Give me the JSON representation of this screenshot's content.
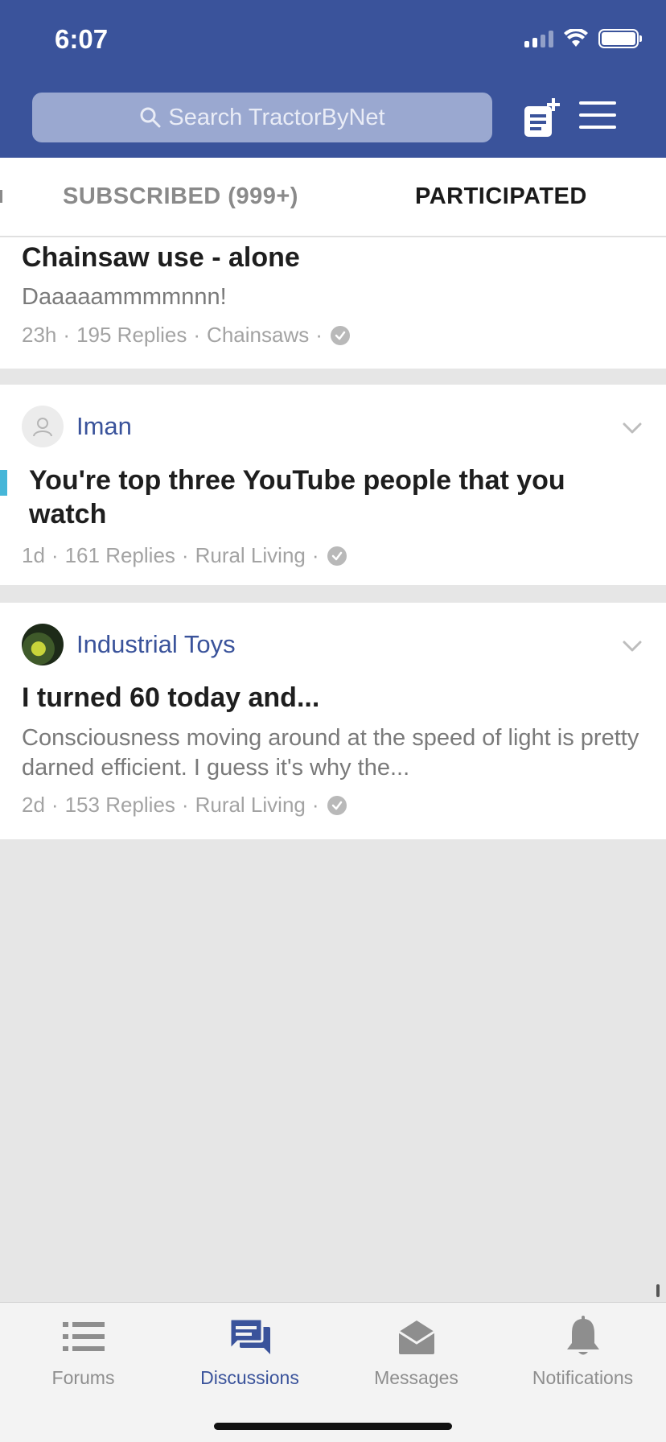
{
  "status_bar": {
    "time": "6:07"
  },
  "header": {
    "search_placeholder": "Search TractorByNet",
    "compose_icon": "new-post-icon",
    "menu_icon": "hamburger-menu-icon"
  },
  "tabs": [
    {
      "label": "SUBSCRIBED (999+)",
      "active": false
    },
    {
      "label": "PARTICIPATED",
      "active": true
    }
  ],
  "threads": [
    {
      "title": "Chainsaw use - alone",
      "snippet": "Daaaaammmmnnn!",
      "age": "23h",
      "replies": "195 Replies",
      "forum": "Chainsaws"
    },
    {
      "author": "Iman",
      "title": "You're top three YouTube people that you watch",
      "age": "1d",
      "replies": "161 Replies",
      "forum": "Rural Living"
    },
    {
      "author": "Industrial Toys",
      "title": "I turned 60 today and...",
      "snippet": "Consciousness moving around at the speed of light is pretty darned efficient. I guess it's why the...",
      "age": "2d",
      "replies": "153 Replies",
      "forum": "Rural Living"
    }
  ],
  "bottom_nav": [
    {
      "label": "Forums",
      "icon": "list-icon",
      "active": false
    },
    {
      "label": "Discussions",
      "icon": "chat-bubbles-icon",
      "active": true
    },
    {
      "label": "Messages",
      "icon": "envelope-open-icon",
      "active": false
    },
    {
      "label": "Notifications",
      "icon": "bell-icon",
      "active": false
    }
  ],
  "colors": {
    "brand": "#3a539b",
    "accent": "#46b6d8"
  }
}
